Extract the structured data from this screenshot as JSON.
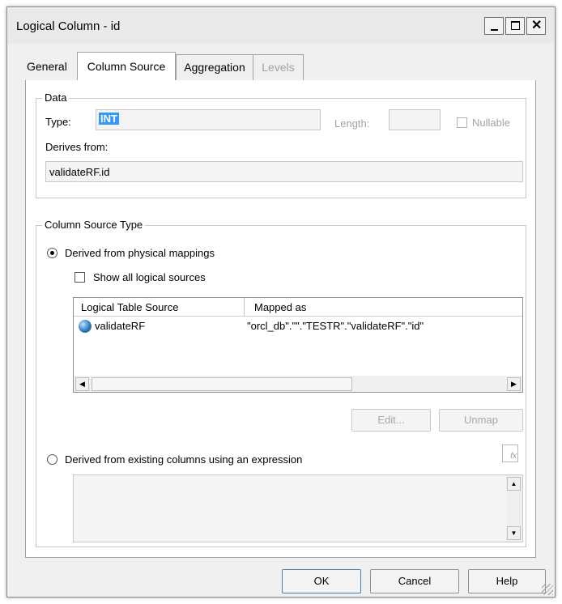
{
  "window": {
    "title": "Logical Column - id",
    "minimize_label": "_",
    "maximize_label": "□",
    "close_label": "✕"
  },
  "tabs": [
    {
      "label": "General",
      "active": false,
      "disabled": false
    },
    {
      "label": "Column Source",
      "active": true,
      "disabled": false
    },
    {
      "label": "Aggregation",
      "active": false,
      "disabled": false
    },
    {
      "label": "Levels",
      "active": false,
      "disabled": true
    }
  ],
  "data_group": {
    "legend": "Data",
    "type_label": "Type:",
    "type_value": "INT",
    "length_label": "Length:",
    "length_value": "",
    "nullable_label": "Nullable",
    "nullable_checked": false,
    "derives_label": "Derives from:",
    "derives_value": "validateRF.id"
  },
  "source_group": {
    "legend": "Column Source Type",
    "radio_physical_label": "Derived from physical mappings",
    "radio_physical_checked": true,
    "show_all_label": "Show all logical sources",
    "show_all_checked": false,
    "table": {
      "columns": [
        "Logical Table Source",
        "Mapped as"
      ],
      "rows": [
        {
          "source": "validateRF",
          "mapped": "\"orcl_db\".\"\".\"TESTR\".\"validateRF\".\"id\""
        }
      ]
    },
    "edit_label": "Edit...",
    "unmap_label": "Unmap",
    "radio_expression_label": "Derived from existing columns using an expression",
    "radio_expression_checked": false,
    "expression_value": "",
    "expression_builder_icon": "fx"
  },
  "footer": {
    "ok_label": "OK",
    "cancel_label": "Cancel",
    "help_label": "Help"
  },
  "colors": {
    "selection": "#3399ff",
    "disabled_text": "#a2a2a2",
    "window_bg": "#f0f0f0"
  }
}
